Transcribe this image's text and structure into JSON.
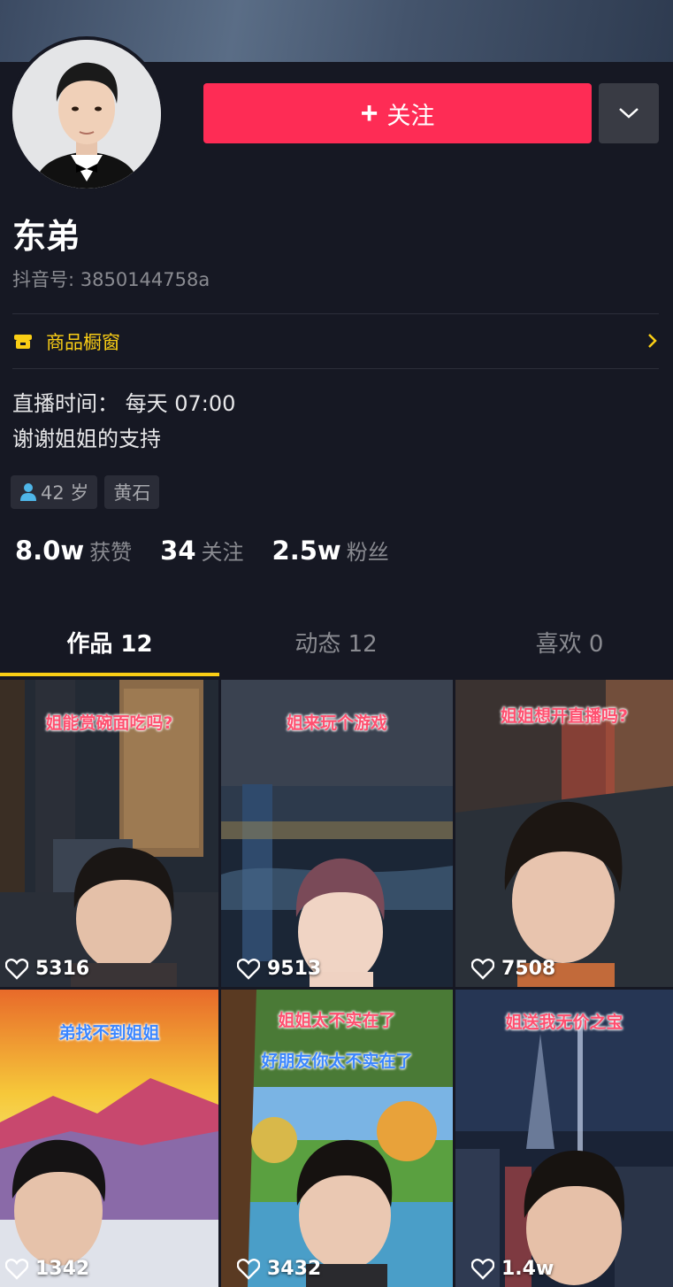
{
  "profile": {
    "name": "东弟",
    "uid": "抖音号: 3850144758a",
    "follow_label": "关注",
    "shop_label": "商品橱窗",
    "bio_line1": "直播时间：  每天 07:00",
    "bio_line2": "谢谢姐姐的支持",
    "tags": [
      "42 岁",
      "黄石"
    ],
    "stats": [
      {
        "num": "8.0w",
        "label": "获赞"
      },
      {
        "num": "34",
        "label": "关注"
      },
      {
        "num": "2.5w",
        "label": "粉丝"
      }
    ]
  },
  "tabs": [
    "作品 12",
    "动态 12",
    "喜欢 0"
  ],
  "videos": [
    {
      "caption": "姐能赏碗面吃吗?",
      "likes": "5316"
    },
    {
      "caption": "姐来玩个游戏",
      "likes": "9513"
    },
    {
      "caption": "姐姐想开直播吗?",
      "likes": "7508"
    },
    {
      "caption": "弟找不到姐姐",
      "likes": "1342"
    },
    {
      "caption": "姐姐太不实在了",
      "caption2": "好朋友你太不实在了",
      "likes": "3432"
    },
    {
      "caption": "姐送我无价之宝",
      "likes": "1.4w"
    }
  ],
  "colors": {
    "accent": "#fe2c55",
    "yellow": "#face15",
    "bg": "#161823"
  }
}
